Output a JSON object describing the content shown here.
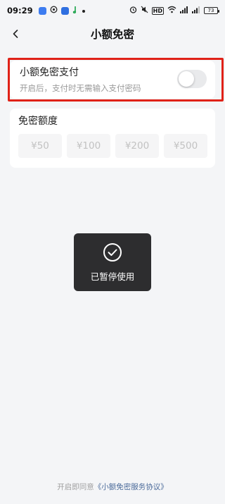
{
  "status_bar": {
    "time": "09:29",
    "network_badge": "HD",
    "battery": "73",
    "icons": [
      "app-icon-blue",
      "app-icon-swirl",
      "app-icon-blue-square",
      "app-icon-green",
      "dot-icon",
      "alarm-icon",
      "mute-icon",
      "hd-icon",
      "wifi-icon",
      "signal-icon",
      "signal-icon",
      "battery-icon"
    ]
  },
  "header": {
    "title": "小额免密",
    "back_icon": "chevron-left-icon"
  },
  "toggle_card": {
    "title": "小额免密支付",
    "description": "开启后，支付时无需输入支付密码",
    "enabled": false
  },
  "limit_card": {
    "title": "免密额度",
    "amounts": [
      "¥50",
      "¥100",
      "¥200",
      "¥500"
    ]
  },
  "toast": {
    "icon": "check-circle-icon",
    "text": "已暂停使用"
  },
  "footer": {
    "prefix": "开启即同意",
    "link": "《小额免密服务协议》"
  },
  "colors": {
    "highlight": "#e02218",
    "background": "#f4f5f7",
    "toast_bg": "#2d2d2f",
    "link": "#4a6a9a"
  }
}
